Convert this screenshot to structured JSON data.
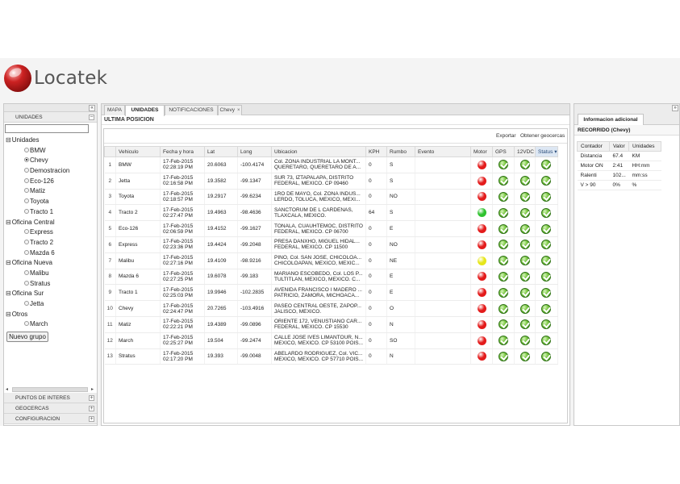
{
  "header": {
    "logo_text": "Locatek"
  },
  "left": {
    "collapse_glyph": "«",
    "unidades_header": "UNIDADES",
    "unidades_toggle": "−",
    "filter_value": "",
    "tree": [
      {
        "group": "Unidades",
        "items": [
          {
            "label": "BMW",
            "selected": false
          },
          {
            "label": "Chevy",
            "selected": true
          },
          {
            "label": "Demostracion",
            "selected": false
          },
          {
            "label": "Eco-126",
            "selected": false
          },
          {
            "label": "Matiz",
            "selected": false
          },
          {
            "label": "Toyota",
            "selected": false
          },
          {
            "label": "Tracto 1",
            "selected": false
          }
        ]
      },
      {
        "group": "Oficina Central",
        "items": [
          {
            "label": "Express",
            "selected": false
          },
          {
            "label": "Tracto 2",
            "selected": false
          },
          {
            "label": "Mazda 6",
            "selected": false
          }
        ]
      },
      {
        "group": "Oficina Nueva",
        "items": [
          {
            "label": "Malibu",
            "selected": false
          },
          {
            "label": "Stratus",
            "selected": false
          }
        ]
      },
      {
        "group": "Oficina Sur",
        "items": [
          {
            "label": "Jetta",
            "selected": false
          }
        ]
      },
      {
        "group": "Otros",
        "items": [
          {
            "label": "March",
            "selected": false
          }
        ]
      }
    ],
    "group_toggle": "⊟",
    "new_group_label": "Nuevo grupo",
    "bottom_sections": [
      {
        "label": "PUNTOS DE INTERES",
        "toggle": "+"
      },
      {
        "label": "GEOCERCAS",
        "toggle": "+"
      },
      {
        "label": "CONFIGURACION",
        "toggle": "+"
      }
    ]
  },
  "center": {
    "tabs": [
      {
        "label": "MAPA",
        "active": false
      },
      {
        "label": "UNIDADES",
        "active": true
      },
      {
        "label": "NOTIFICACIONES",
        "active": false
      },
      {
        "label": "Chevy",
        "active": false,
        "closable": true
      }
    ],
    "section_title": "ULTIMA POSICION",
    "tools": {
      "export": "Exportar",
      "geofences": "Obtener geocercas"
    },
    "columns": [
      "Vehiculo",
      "Fecha y hora",
      "Lat",
      "Long",
      "Ubicacion",
      "KPH",
      "Rumbo",
      "Evento",
      "Motor",
      "GPS",
      "12VDC",
      "Status"
    ],
    "sorted_column": "Status",
    "rows": [
      {
        "n": "1",
        "veh": "BMW",
        "date": "17-Feb-2015",
        "time": "02:28:19 PM",
        "lat": "20.6063",
        "long": "-100.4174",
        "loc1": "Col. ZONA INDUSTRIAL LA MONT...",
        "loc2": "QUERETARO, QUERETARO DE A...",
        "kph": "0",
        "rumbo": "S",
        "evento": "",
        "motor": "red"
      },
      {
        "n": "2",
        "veh": "Jetta",
        "date": "17-Feb-2015",
        "time": "02:16:58 PM",
        "lat": "19.3582",
        "long": "-99.1347",
        "loc1": "SUR 73, IZTAPALAPA, DISTRITO",
        "loc2": "FEDERAL, MEXICO. CP 09460",
        "kph": "0",
        "rumbo": "S",
        "evento": "",
        "motor": "red"
      },
      {
        "n": "3",
        "veh": "Toyota",
        "date": "17-Feb-2015",
        "time": "02:18:57 PM",
        "lat": "19.2917",
        "long": "-99.6234",
        "loc1": "1RO DE MAYO, Col. ZONA INDUS...",
        "loc2": "LERDO, TOLUCA, MEXICO, MEXI...",
        "kph": "0",
        "rumbo": "NO",
        "evento": "",
        "motor": "red"
      },
      {
        "n": "4",
        "veh": "Tracto 2",
        "date": "17-Feb-2015",
        "time": "02:27:47 PM",
        "lat": "19.4963",
        "long": "-98.4636",
        "loc1": "SANCTORUM DE L CARDENAS,",
        "loc2": "TLAXCALA, MEXICO.",
        "kph": "64",
        "rumbo": "S",
        "evento": "",
        "motor": "green"
      },
      {
        "n": "5",
        "veh": "Eco-126",
        "date": "17-Feb-2015",
        "time": "02:06:59 PM",
        "lat": "19.4152",
        "long": "-99.1627",
        "loc1": "TONALA, CUAUHTEMOC, DISTRITO",
        "loc2": "FEDERAL, MEXICO. CP 06700",
        "kph": "0",
        "rumbo": "E",
        "evento": "",
        "motor": "red"
      },
      {
        "n": "6",
        "veh": "Express",
        "date": "17-Feb-2015",
        "time": "02:23:36 PM",
        "lat": "19.4424",
        "long": "-99.2048",
        "loc1": "PRESA DANXHO, MIGUEL HIDAL...",
        "loc2": "FEDERAL, MEXICO. CP 11500",
        "kph": "0",
        "rumbo": "NO",
        "evento": "",
        "motor": "red"
      },
      {
        "n": "7",
        "veh": "Malibu",
        "date": "17-Feb-2015",
        "time": "02:27:16 PM",
        "lat": "19.4109",
        "long": "-98.9216",
        "loc1": "PINO, Col. SAN JOSE, CHICOLOA...",
        "loc2": "CHICOLOAPAN, MEXICO, MEXIC...",
        "kph": "0",
        "rumbo": "NE",
        "evento": "",
        "motor": "yellow"
      },
      {
        "n": "8",
        "veh": "Mazda 6",
        "date": "17-Feb-2015",
        "time": "02:27:25 PM",
        "lat": "19.6078",
        "long": "-99.183",
        "loc1": "MARIANO ESCOBEDO, Col. LOS P...",
        "loc2": "TULTITLAN, MEXICO, MEXICO. C...",
        "kph": "0",
        "rumbo": "E",
        "evento": "",
        "motor": "red"
      },
      {
        "n": "9",
        "veh": "Tracto 1",
        "date": "17-Feb-2015",
        "time": "02:25:03 PM",
        "lat": "19.9946",
        "long": "-102.2835",
        "loc1": "AVENIDA FRANCISCO I MADERO ...",
        "loc2": "PATRICIO, ZAMORA, MICHOACA...",
        "kph": "0",
        "rumbo": "E",
        "evento": "",
        "motor": "red"
      },
      {
        "n": "10",
        "veh": "Chevy",
        "date": "17-Feb-2015",
        "time": "02:24:47 PM",
        "lat": "20.7265",
        "long": "-103.4916",
        "loc1": "PASEO CENTRAL OESTE, ZAPOP...",
        "loc2": "JALISCO, MEXICO.",
        "kph": "0",
        "rumbo": "O",
        "evento": "",
        "motor": "red"
      },
      {
        "n": "11",
        "veh": "Matiz",
        "date": "17-Feb-2015",
        "time": "02:22:21 PM",
        "lat": "19.4389",
        "long": "-99.0896",
        "loc1": "ORIENTE 172, VENUSTIANO CAR...",
        "loc2": "FEDERAL, MEXICO. CP 15530",
        "kph": "0",
        "rumbo": "N",
        "evento": "",
        "motor": "red"
      },
      {
        "n": "12",
        "veh": "March",
        "date": "17-Feb-2015",
        "time": "02:25:27 PM",
        "lat": "19.504",
        "long": "-99.2474",
        "loc1": "CALLE JOSE IVES LIMANTOUR, N...",
        "loc2": "MEXICO, MEXICO. CP 53100 POIS...",
        "kph": "0",
        "rumbo": "SO",
        "evento": "",
        "motor": "red"
      },
      {
        "n": "13",
        "veh": "Stratus",
        "date": "17-Feb-2015",
        "time": "02:17:20 PM",
        "lat": "19.393",
        "long": "-99.0048",
        "loc1": "ABELARDO RODRIGUEZ, Col. VIC...",
        "loc2": "MEXICO, MEXICO. CP 57710 POIS...",
        "kph": "0",
        "rumbo": "N",
        "evento": "",
        "motor": "red"
      }
    ]
  },
  "right": {
    "collapse_glyph": "»",
    "tab_label": "Informacion adicional",
    "section_title": "RECORRIDO (Chevy)",
    "columns": [
      "Contador",
      "Valor",
      "Unidades"
    ],
    "rows": [
      {
        "contador": "Distancia",
        "valor": "67.4",
        "unidades": "KM"
      },
      {
        "contador": "Motor ON",
        "valor": "2:41",
        "unidades": "HH:mm"
      },
      {
        "contador": "Ralenti",
        "valor": "102...",
        "unidades": "mm:ss"
      },
      {
        "contador": "V > 90",
        "valor": "0%",
        "unidades": "%"
      }
    ]
  },
  "colors": {
    "motor_red": "#e31b1b",
    "motor_green": "#2fc22f",
    "motor_yellow": "#e6e61a",
    "gps_ok": "#4fa82a"
  }
}
